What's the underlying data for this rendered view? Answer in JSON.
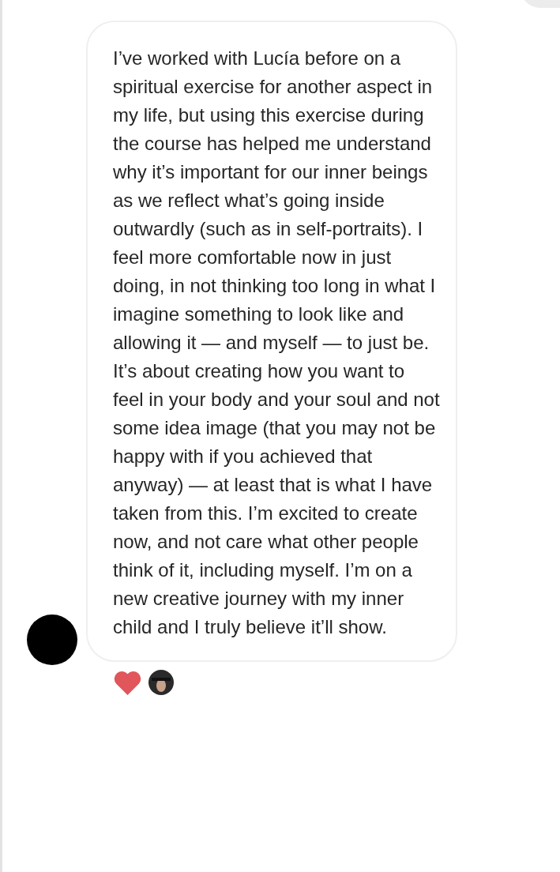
{
  "message": {
    "text": "I’ve worked with Lucía before on a spiritual exercise for another aspect in my life, but using this exercise during the course has helped me understand why it’s important for our inner beings as we reflect what’s going inside outwardly (such as in self-portraits). I feel more comfortable now in just doing, in not thinking too long in what I imagine something to look like and allowing it — and myself — to just be. It’s about creating how you want to feel in your body and your soul and not some idea image (that you may not be happy with if you achieved that anyway) — at least that is what I have taken from this. I’m excited to create now, and not care what other people think of it, including myself. I’m on a new creative journey with my inner child and I truly believe it’ll show.",
    "reactions": [
      {
        "kind": "heart"
      },
      {
        "kind": "avatar"
      }
    ]
  }
}
